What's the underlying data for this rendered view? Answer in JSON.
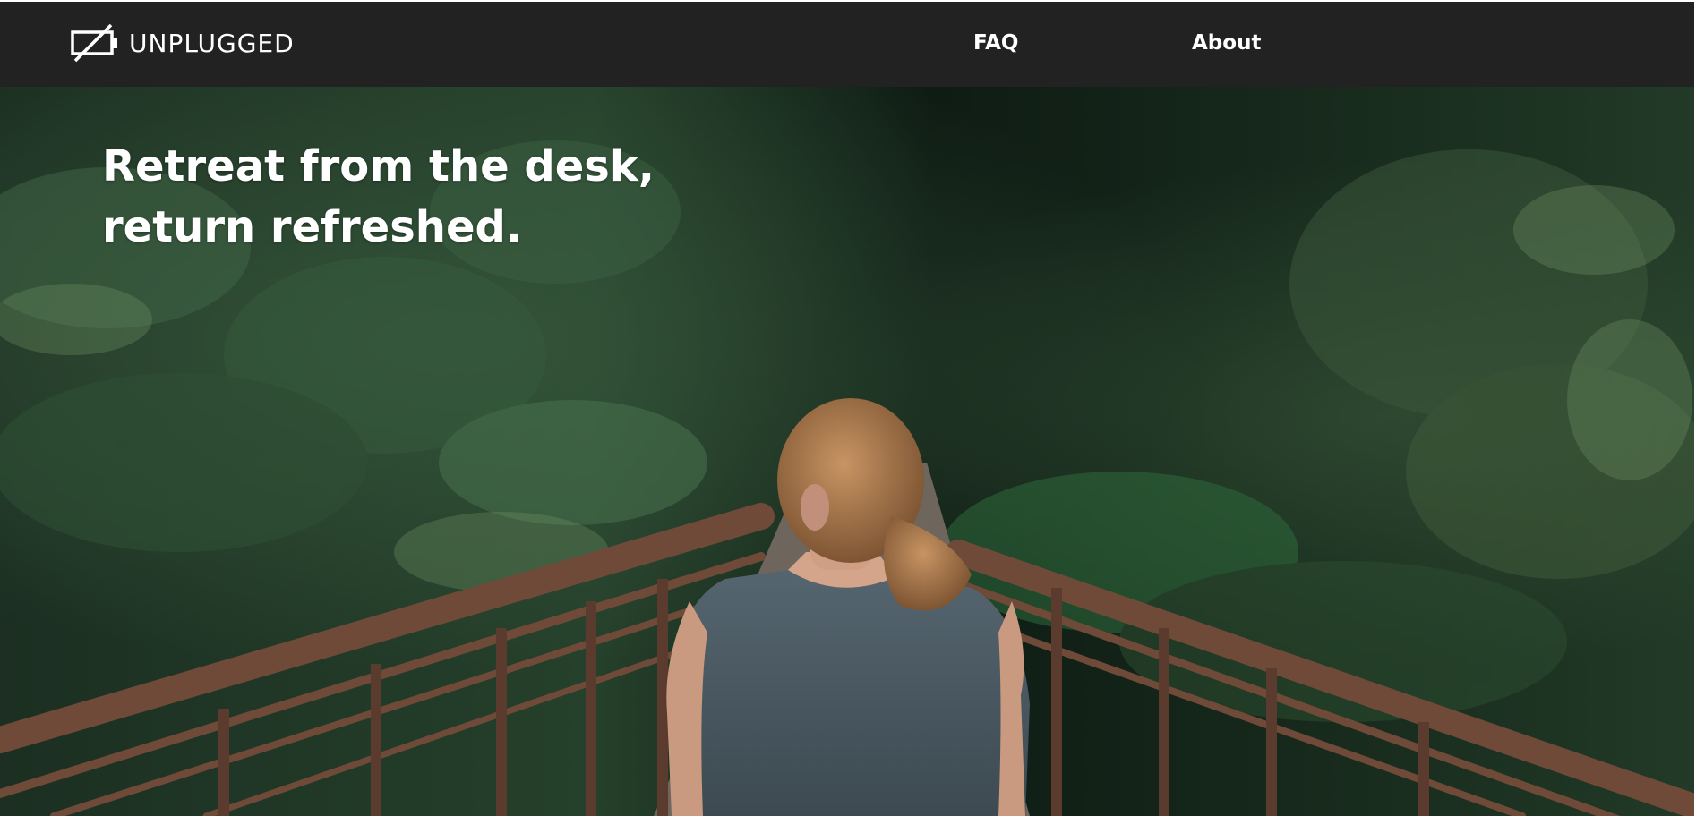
{
  "header": {
    "brand": "UNPLUGGED",
    "nav": [
      {
        "label": "FAQ"
      },
      {
        "label": "About"
      }
    ]
  },
  "hero": {
    "title_line1": "Retreat from the desk,",
    "title_line2": "return refreshed.",
    "image": "forest-bridge-woman"
  },
  "colors": {
    "header_bg": "#222222",
    "text": "#ffffff",
    "forest_dark": "#14231a",
    "forest_mid": "#2f4a33",
    "railing": "#6b4a3a",
    "shirt": "#4b5a63",
    "hair": "#a7774c"
  },
  "icons": {
    "logo": "unplugged-battery-icon"
  }
}
